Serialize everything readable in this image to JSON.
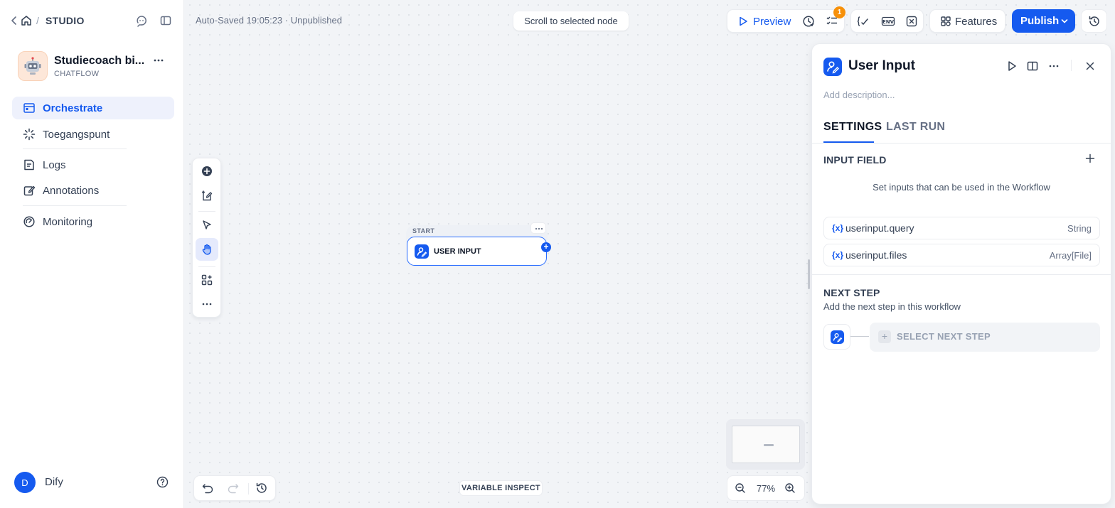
{
  "sidebar": {
    "breadcrumb_section": "STUDIO",
    "app": {
      "name": "Studiecoach bi...",
      "type": "CHATFLOW"
    },
    "nav": [
      {
        "label": "Orchestrate",
        "active": true
      },
      {
        "label": "Toegangspunt",
        "active": false
      },
      {
        "label": "Logs",
        "active": false
      },
      {
        "label": "Annotations",
        "active": false
      },
      {
        "label": "Monitoring",
        "active": false
      }
    ],
    "user": {
      "initial": "D",
      "name": "Dify"
    }
  },
  "header": {
    "autosave": "Auto-Saved 19:05:23 · Unpublished",
    "scroll_to_node": "Scroll to selected node",
    "preview_label": "Preview",
    "checklist_count": "1",
    "env_label": "ENV",
    "features_label": "Features",
    "publish_label": "Publish"
  },
  "canvas": {
    "node": {
      "header": "START",
      "title": "USER INPUT"
    },
    "variable_inspect": "VARIABLE INSPECT",
    "zoom": "77%"
  },
  "panel": {
    "title": "User Input",
    "description_placeholder": "Add description...",
    "tabs": [
      {
        "label": "SETTINGS",
        "active": true
      },
      {
        "label": "LAST RUN",
        "active": false
      }
    ],
    "input_field_title": "INPUT FIELD",
    "input_field_hint": "Set inputs that can be used in the Workflow",
    "variables": [
      {
        "icon": "{x}",
        "name": "userinput.query",
        "type": "String"
      },
      {
        "icon": "{x}",
        "name": "userinput.files",
        "type": "Array[File]"
      }
    ],
    "next_step_title": "NEXT STEP",
    "next_step_subtitle": "Add the next step in this workflow",
    "select_next_step": "SELECT NEXT STEP"
  },
  "colors": {
    "accent": "#155aef",
    "badge": "#f79009",
    "active_nav_bg": "#eef1fc"
  }
}
